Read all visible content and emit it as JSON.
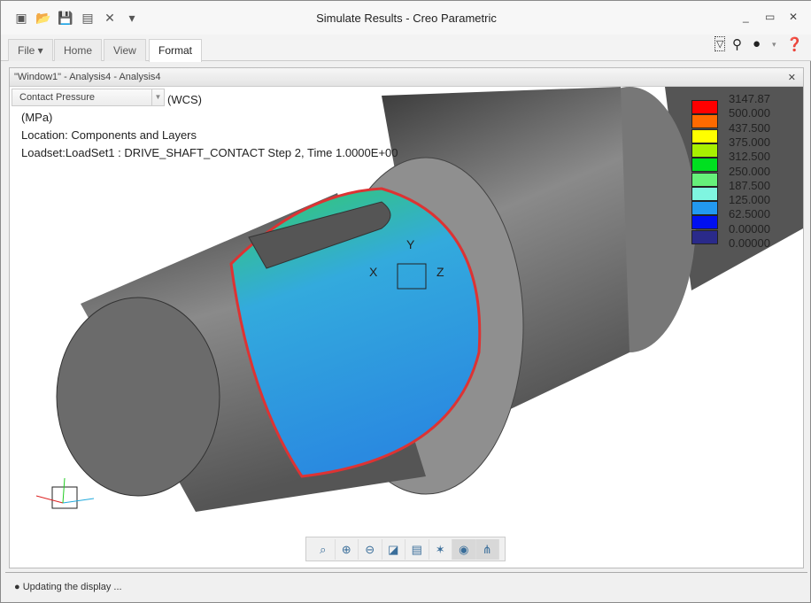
{
  "app": {
    "title": "Simulate Results - Creo Parametric"
  },
  "quick_access": [
    {
      "icon": "new-window-icon",
      "glyph": "▣"
    },
    {
      "icon": "open-folder-icon",
      "glyph": "📂"
    },
    {
      "icon": "save-icon",
      "glyph": "💾"
    },
    {
      "icon": "save-as-icon",
      "glyph": "▤"
    },
    {
      "icon": "close-window-icon",
      "glyph": "✕"
    },
    {
      "icon": "customize-dropdown-icon",
      "glyph": "▾"
    }
  ],
  "window_controls": {
    "minimize": "_",
    "restore": "▭",
    "close": "✕"
  },
  "tabs": [
    {
      "label": "File ▾"
    },
    {
      "label": "Home"
    },
    {
      "label": "View"
    },
    {
      "label": "Format",
      "active": true
    }
  ],
  "inner_window": {
    "title": "\"Window1\" - Analysis4 - Analysis4",
    "close": "✕"
  },
  "result_select": {
    "value": "Contact Pressure"
  },
  "info": {
    "csys": "(WCS)",
    "units": "(MPa)",
    "location": "Location: Components and Layers",
    "loadset": "Loadset:LoadSet1 :  DRIVE_SHAFT_CONTACT Step 2, Time  1.0000E+00"
  },
  "legend": [
    {
      "value": "3147.87",
      "color": "#ff0000"
    },
    {
      "value": "500.000",
      "color": "#ff6a00"
    },
    {
      "value": "437.500",
      "color": "#ffff00"
    },
    {
      "value": "375.000",
      "color": "#a8f000"
    },
    {
      "value": "312.500",
      "color": "#00e020"
    },
    {
      "value": "250.000",
      "color": "#66f07a"
    },
    {
      "value": "187.500",
      "color": "#7ff5e0"
    },
    {
      "value": "125.000",
      "color": "#2299f0"
    },
    {
      "value": "62.5000",
      "color": "#0010f0"
    },
    {
      "value": "0.00000",
      "color": "#2a2a8a"
    },
    {
      "value": "0.00000",
      "color": null
    }
  ],
  "view_toolbar": [
    {
      "icon": "refit-icon",
      "glyph": "⌕"
    },
    {
      "icon": "zoom-in-icon",
      "glyph": "⊕"
    },
    {
      "icon": "zoom-out-icon",
      "glyph": "⊖"
    },
    {
      "icon": "display-style-icon",
      "glyph": "◪"
    },
    {
      "icon": "saved-views-icon",
      "glyph": "▤"
    },
    {
      "icon": "spin-center-icon",
      "glyph": "✶"
    },
    {
      "icon": "annotation-display-icon",
      "glyph": "◉",
      "active": true
    },
    {
      "icon": "datum-display-icon",
      "glyph": "⋔",
      "active": true
    }
  ],
  "status": {
    "text": "Updating the display ..."
  }
}
